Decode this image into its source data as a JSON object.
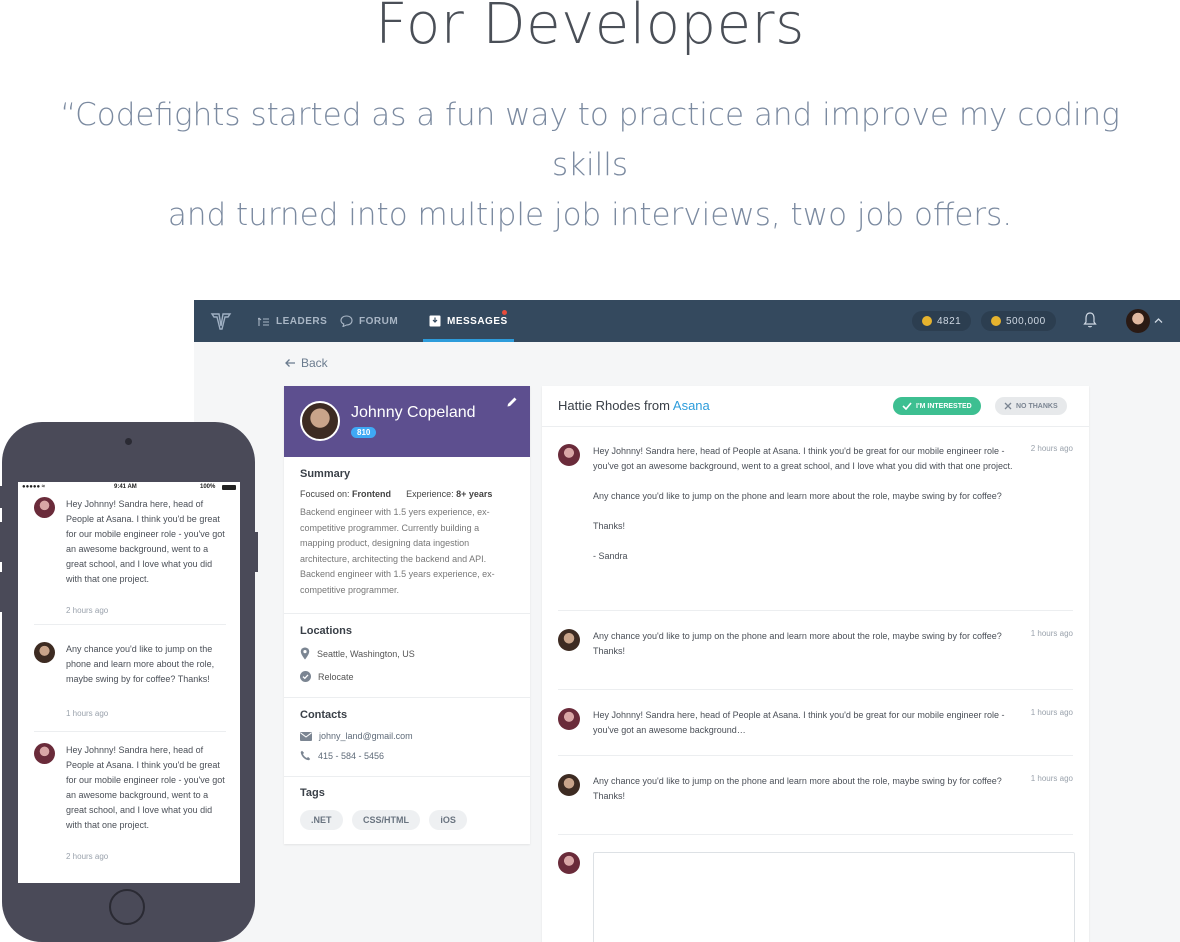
{
  "hero": {
    "title": "For Developers",
    "quote_line1": "“Codefights started as a fun way to practice and improve my coding skills",
    "quote_line2": "and  turned into multiple job interviews, two job offers."
  },
  "nav": {
    "items": [
      {
        "label": "LEADERS",
        "icon": "leaders-icon"
      },
      {
        "label": "FORUM",
        "icon": "forum-icon"
      },
      {
        "label": "MESSAGES",
        "icon": "messages-icon",
        "active": true
      }
    ],
    "coins": "4821",
    "xp": "500,000"
  },
  "back_label": "Back",
  "profile": {
    "name": "Johnny Copeland",
    "badge": "810",
    "summary_heading": "Summary",
    "focused_label": "Focused on:",
    "focused_value": "Frontend",
    "experience_label": "Experience:",
    "experience_value": "8+ years",
    "summary_text": "Backend engineer with 1.5 yers experience, ex-competitive programmer. Currently building a mapping product, designing data ingestion architecture, architecting the backend and API. Backend engineer with 1.5 years experience, ex-competitive programmer.",
    "locations_heading": "Locations",
    "location": "Seattle,  Washington, US",
    "relocate": "Relocate",
    "contacts_heading": "Contacts",
    "email": "johny_land@gmail.com",
    "phone": "415 - 584 - 5456",
    "tags_heading": "Tags",
    "tags": [
      ".NET",
      "CSS/HTML",
      "iOS"
    ]
  },
  "messages": {
    "header_name": "Hattie Rhodes from",
    "header_company": "Asana",
    "interested_label": "I'M INTERESTED",
    "no_thanks_label": "NO THANKS",
    "items": [
      {
        "text": "Hey Johnny! Sandra here, head of People at Asana. I think you'd be great for our mobile engineer role - you've got an awesome background, went to a great school, and I love what you did with that one project.\n\nAny chance you'd like to jump on the phone and learn more about the role, maybe swing by for coffee?\n\nThanks!\n\n- Sandra",
        "time": "2 hours ago"
      },
      {
        "text": "Any chance you'd like to jump on the phone and learn more about the role, maybe swing by for coffee?\nThanks!",
        "time": "1 hours ago"
      },
      {
        "text": "Hey Johnny! Sandra here, head of People at Asana. I think you'd be great for our mobile engineer role - you've got an awesome background…",
        "time": "1 hours ago"
      },
      {
        "text": "Any chance you'd like to jump on the phone and learn more about the role, maybe swing by for coffee?\nThanks!",
        "time": "1 hours ago"
      }
    ]
  },
  "phone": {
    "status_time": "9:41 AM",
    "battery": "100%",
    "items": [
      {
        "text": "Hey Johnny! Sandra here, head of People at Asana. I think you'd be great for our mobile engineer role - you've got an awesome background, went to a great school, and I love what you did with that one project.",
        "time": "2 hours ago"
      },
      {
        "text": "Any chance you'd like to jump on the phone and learn more about the role, maybe swing by for coffee? Thanks!",
        "time": "1 hours ago"
      },
      {
        "text": "Hey Johnny! Sandra here, head of People at Asana. I think you'd be great for our mobile engineer role - you've got an awesome background, went to a great school, and I love what you did with that one project.",
        "time": "2 hours ago"
      }
    ]
  },
  "colors": {
    "nav_bg": "#34495e",
    "profile_header": "#5d4f8f",
    "accent_blue": "#2d9cdb",
    "interested_green": "#3dbf91",
    "phone_body": "#4a4a58"
  }
}
